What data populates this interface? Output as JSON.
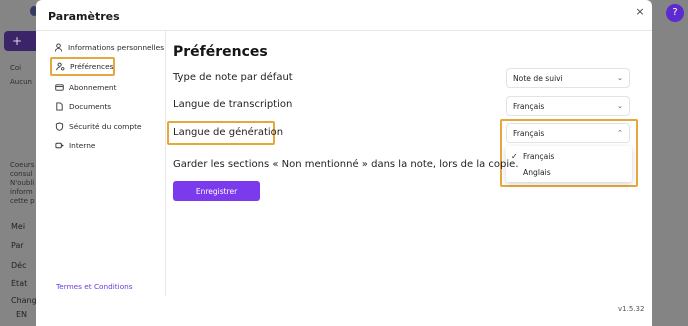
{
  "background": {
    "new_button_label": "+",
    "text_lines": [
      "Coi",
      "Aucun",
      "Coeurs",
      "consul",
      "N'oubli",
      "inform",
      "cette p"
    ],
    "nav_items": [
      "Mei",
      "Par",
      "Déc",
      "État",
      "Chang",
      "EN"
    ],
    "help_label": "?"
  },
  "modal": {
    "title": "Paramètres",
    "close_label": "×",
    "sidebar": {
      "items": [
        {
          "label": "Informations personnelles",
          "icon": "user-icon"
        },
        {
          "label": "Préférences",
          "icon": "user-settings-icon"
        },
        {
          "label": "Abonnement",
          "icon": "credit-card-icon"
        },
        {
          "label": "Documents",
          "icon": "document-icon"
        },
        {
          "label": "Sécurité du compte",
          "icon": "shield-icon"
        },
        {
          "label": "Interne",
          "icon": "tag-icon"
        }
      ],
      "terms_label": "Termes et Conditions"
    },
    "content": {
      "title": "Préférences",
      "rows": [
        {
          "label": "Type de note par défaut",
          "value": "Note de suivi"
        },
        {
          "label": "Langue de transcription",
          "value": "Français"
        },
        {
          "label": "Langue de génération",
          "value": "Français"
        }
      ],
      "dropdown_options": [
        {
          "label": "Français",
          "selected": true
        },
        {
          "label": "Anglais",
          "selected": false
        }
      ],
      "keep_sections_text": "Garder les sections « Non mentionné » dans la note, lors de la copie.",
      "save_label": "Enregistrer"
    },
    "version": "v1.5.32"
  },
  "colors": {
    "accent": "#7c3aed",
    "highlight": "#e6a83c",
    "help_button": "#5b2bd0"
  }
}
